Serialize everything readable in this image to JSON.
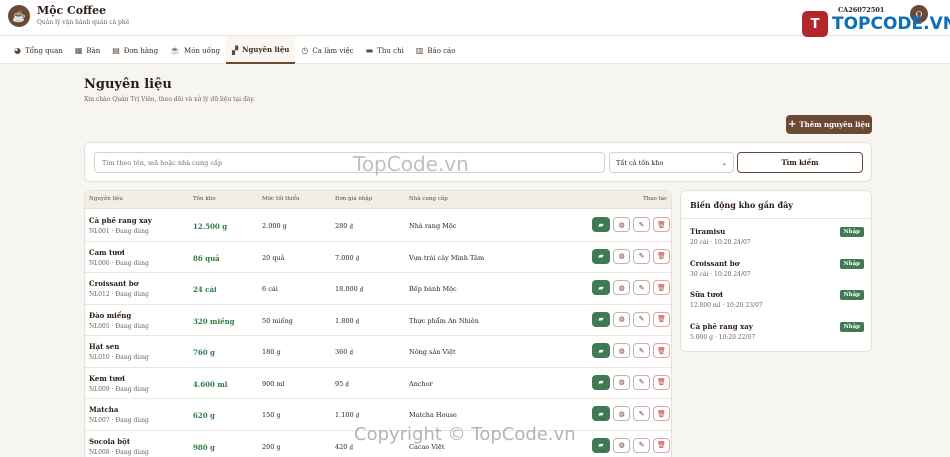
{
  "app": {
    "logo_glyph": "☕",
    "name": "Mộc Coffee",
    "subtitle": "Quản lý vận hành quán cà phê",
    "user_code": "CA26072501",
    "avatar_letter": "Q"
  },
  "watermark": {
    "logo_mark": "T",
    "logo_text": "TOPCODE.VN",
    "center_text": "TopCode.vn",
    "copyright": "Copyright © TopCode.vn"
  },
  "nav": [
    {
      "label": "Tổng quan",
      "icon": "dashboard-icon",
      "glyph": "◕",
      "active": false
    },
    {
      "label": "Bàn",
      "icon": "table-icon",
      "glyph": "▦",
      "active": false
    },
    {
      "label": "Đơn hàng",
      "icon": "receipt-icon",
      "glyph": "▤",
      "active": false
    },
    {
      "label": "Món uống",
      "icon": "cup-icon",
      "glyph": "☕",
      "active": false
    },
    {
      "label": "Nguyên liệu",
      "icon": "boxes-icon",
      "glyph": "▞",
      "active": true
    },
    {
      "label": "Ca làm việc",
      "icon": "clock-icon",
      "glyph": "◷",
      "active": false
    },
    {
      "label": "Thu chi",
      "icon": "wallet-icon",
      "glyph": "▬",
      "active": false
    },
    {
      "label": "Báo cáo",
      "icon": "chart-icon",
      "glyph": "▥",
      "active": false
    }
  ],
  "page": {
    "title": "Nguyên liệu",
    "subtitle": "Xin chào Quản Trị Viên, theo dõi và xử lý dữ liệu tại đây.",
    "add_button": "Thêm nguyên liệu"
  },
  "filter": {
    "search_placeholder": "Tìm theo tên, mã hoặc nhà cung cấp",
    "stock_select": "Tất cả tồn kho",
    "search_button": "Tìm kiếm"
  },
  "table": {
    "headers": {
      "name": "Nguyên liệu",
      "stock": "Tồn kho",
      "min": "Mức tối thiểu",
      "price": "Đơn giá nhập",
      "supplier": "Nhà cung cấp",
      "actions": "Thao tác"
    },
    "rows": [
      {
        "name": "Cà phê rang xay",
        "code": "NL001 · Đang dùng",
        "stock": "12.500 g",
        "min": "2.000 g",
        "price": "280 ₫",
        "supplier": "Nhà rang Mộc"
      },
      {
        "name": "Cam tươi",
        "code": "NL006 · Đang dùng",
        "stock": "86 quả",
        "min": "20 quả",
        "price": "7.000 ₫",
        "supplier": "Vựa trái cây Minh Tâm"
      },
      {
        "name": "Croissant bơ",
        "code": "NL012 · Đang dùng",
        "stock": "24 cái",
        "min": "6 cái",
        "price": "18.000 ₫",
        "supplier": "Bếp bánh Mộc"
      },
      {
        "name": "Đào miếng",
        "code": "NL005 · Đang dùng",
        "stock": "320 miếng",
        "min": "50 miếng",
        "price": "1.800 ₫",
        "supplier": "Thực phẩm An Nhiên"
      },
      {
        "name": "Hạt sen",
        "code": "NL010 · Đang dùng",
        "stock": "760 g",
        "min": "180 g",
        "price": "360 ₫",
        "supplier": "Nông sản Việt"
      },
      {
        "name": "Kem tươi",
        "code": "NL009 · Đang dùng",
        "stock": "4.600 ml",
        "min": "900 ml",
        "price": "95 ₫",
        "supplier": "Anchor"
      },
      {
        "name": "Matcha",
        "code": "NL007 · Đang dùng",
        "stock": "620 g",
        "min": "150 g",
        "price": "1.100 ₫",
        "supplier": "Matcha House"
      },
      {
        "name": "Socola bột",
        "code": "NL008 · Đang dùng",
        "stock": "980 g",
        "min": "200 g",
        "price": "420 ₫",
        "supplier": "Cacao Việt"
      }
    ]
  },
  "movements": {
    "title": "Biến động kho gần đây",
    "items": [
      {
        "name": "Tiramisu",
        "meta": "20 cái · 10:20 24/07",
        "badge": "Nhập"
      },
      {
        "name": "Croissant bơ",
        "meta": "30 cái · 10:20 24/07",
        "badge": "Nhập"
      },
      {
        "name": "Sữa tươi",
        "meta": "12.000 ml · 10:20 23/07",
        "badge": "Nhập"
      },
      {
        "name": "Cà phê rang xay",
        "meta": "5.000 g · 10:20 22/07",
        "badge": "Nhập"
      }
    ]
  },
  "colors": {
    "brand": "#6b4a35",
    "stock_green": "#2f7a45",
    "import_green": "#3f7a53",
    "danger": "#c0392b"
  }
}
